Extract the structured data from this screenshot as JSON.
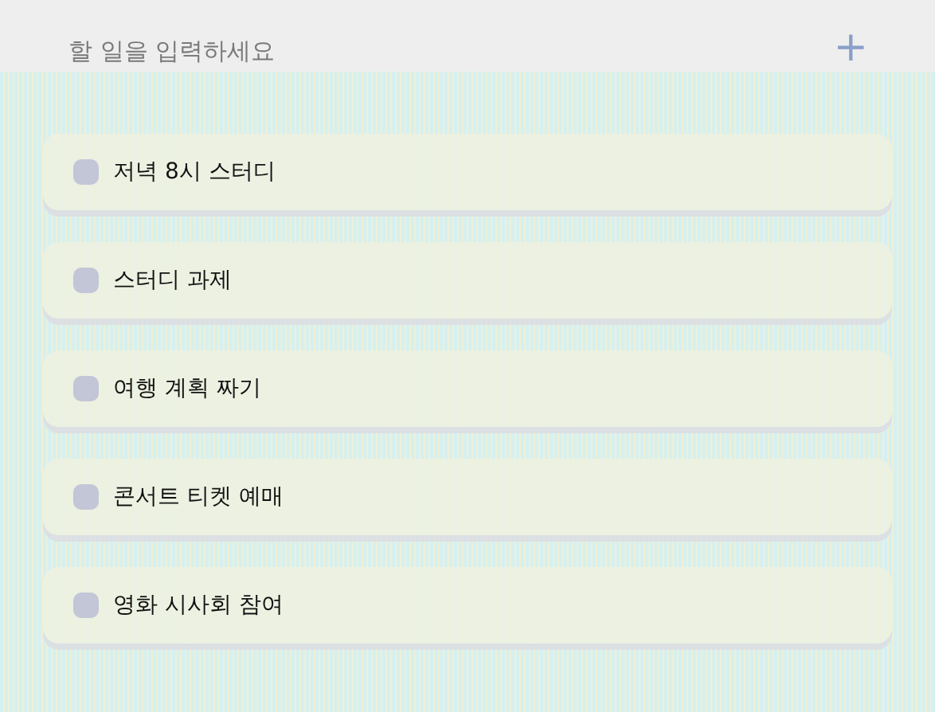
{
  "new_todo": {
    "placeholder": "할 일을 입력하세요",
    "add_button": "+"
  },
  "todos": [
    {
      "text": "저녁 8시 스터디",
      "checked": false
    },
    {
      "text": "스터디 과제",
      "checked": false
    },
    {
      "text": "여행 계획 짜기",
      "checked": false
    },
    {
      "text": "콘서트 티켓 예매",
      "checked": false
    },
    {
      "text": "영화 시사회 참여",
      "checked": false
    }
  ]
}
